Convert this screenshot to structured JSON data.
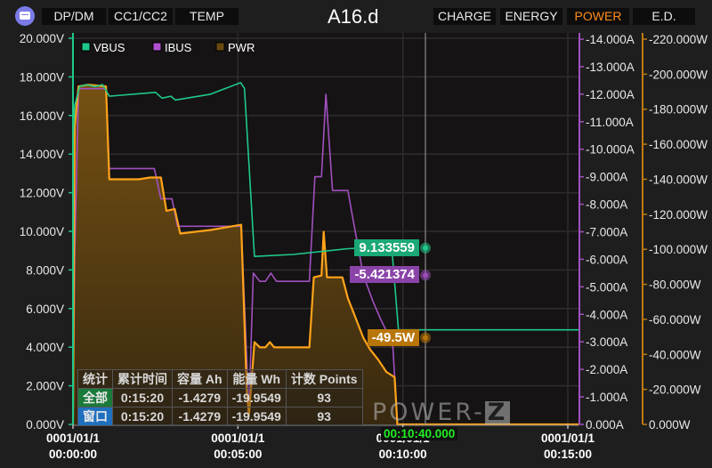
{
  "header": {
    "title": "A16.d",
    "left_tabs": [
      {
        "label": "DP/DM"
      },
      {
        "label": "CC1/CC2"
      },
      {
        "label": "TEMP"
      }
    ],
    "right_tabs": [
      {
        "label": "CHARGE",
        "active": false
      },
      {
        "label": "ENERGY",
        "active": false
      },
      {
        "label": "POWER",
        "active": true
      },
      {
        "label": "E.D.",
        "active": false
      }
    ]
  },
  "colors": {
    "vbus": "#1fc98a",
    "ibus": "#a050c0",
    "pwr": "#ffa31a",
    "pwr_fill": "#6b4a10",
    "active_tab": "#ff8c1a",
    "cursor_time": "#22ee22"
  },
  "chart_data": {
    "type": "line",
    "title": "A16.d",
    "xlabel": "",
    "x_unit": "seconds",
    "xlim": [
      0,
      920
    ],
    "x_ticks": [
      {
        "value": 0,
        "label_date": "0001/01/1",
        "label_time": "00:00:00"
      },
      {
        "value": 300,
        "label_date": "0001/01/1",
        "label_time": "00:05:00"
      },
      {
        "value": 600,
        "label_date": "0001/01/1",
        "label_time": "00:10:00"
      },
      {
        "value": 900,
        "label_date": "0001/01/1",
        "label_time": "00:15:00"
      }
    ],
    "axes": {
      "voltage": {
        "position": "left",
        "range": [
          0,
          20
        ],
        "ticks": [
          "0.000V",
          "2.000V",
          "4.000V",
          "6.000V",
          "8.000V",
          "10.000V",
          "12.000V",
          "14.000V",
          "16.000V",
          "18.000V",
          "20.000V"
        ]
      },
      "current": {
        "position": "right",
        "range": [
          0,
          -14
        ],
        "ticks": [
          "0.000A",
          "-1.000A",
          "-2.000A",
          "-3.000A",
          "-4.000A",
          "-5.000A",
          "-6.000A",
          "-7.000A",
          "-8.000A",
          "-9.000A",
          "-10.000A",
          "-11.000A",
          "-12.000A",
          "-13.000A",
          "-14.000A"
        ]
      },
      "power": {
        "position": "far-right",
        "range": [
          0,
          -220
        ],
        "ticks": [
          "0.000W",
          "-20.000W",
          "-40.000W",
          "-60.000W",
          "-80.000W",
          "-100.000W",
          "-120.000W",
          "-140.000W",
          "-160.000W",
          "-180.000W",
          "-200.000W",
          "-220.000W"
        ]
      }
    },
    "legend": {
      "placement": "top-left",
      "entries": [
        "VBUS",
        "IBUS",
        "PWR"
      ]
    },
    "grid": true,
    "series": [
      {
        "name": "VBUS",
        "axis": "voltage",
        "points": [
          [
            0,
            14.8
          ],
          [
            3,
            16.5
          ],
          [
            12,
            17.5
          ],
          [
            24,
            17.6
          ],
          [
            40,
            17.5
          ],
          [
            54,
            17.6
          ],
          [
            66,
            17.0
          ],
          [
            150,
            17.2
          ],
          [
            162,
            16.9
          ],
          [
            178,
            17.0
          ],
          [
            186,
            16.8
          ],
          [
            250,
            17.1
          ],
          [
            305,
            17.7
          ],
          [
            312,
            17.4
          ],
          [
            330,
            8.7
          ],
          [
            400,
            8.8
          ],
          [
            500,
            9.1
          ],
          [
            528,
            9.133
          ],
          [
            580,
            9.1
          ],
          [
            592,
            4.9
          ],
          [
            920,
            4.9
          ]
        ]
      },
      {
        "name": "IBUS",
        "axis": "current",
        "points": [
          [
            0,
            0
          ],
          [
            3,
            -6.0
          ],
          [
            10,
            -12.2
          ],
          [
            60,
            -12.2
          ],
          [
            66,
            -9.3
          ],
          [
            148,
            -9.3
          ],
          [
            160,
            -8.2
          ],
          [
            180,
            -8.2
          ],
          [
            190,
            -7.2
          ],
          [
            306,
            -7.2
          ],
          [
            320,
            -0.5
          ],
          [
            328,
            -5.5
          ],
          [
            340,
            -5.2
          ],
          [
            350,
            -5.2
          ],
          [
            360,
            -5.5
          ],
          [
            370,
            -5.2
          ],
          [
            430,
            -5.2
          ],
          [
            440,
            -9.0
          ],
          [
            452,
            -9.0
          ],
          [
            460,
            -12.0
          ],
          [
            472,
            -8.5
          ],
          [
            500,
            -8.5
          ],
          [
            508,
            -7.6
          ],
          [
            528,
            -5.421
          ],
          [
            545,
            -4.5
          ],
          [
            560,
            -3.8
          ],
          [
            570,
            -3.4
          ],
          [
            582,
            -2.8
          ],
          [
            590,
            0
          ],
          [
            920,
            0
          ]
        ]
      },
      {
        "name": "PWR",
        "axis": "power",
        "filled": true,
        "points": [
          [
            0,
            0
          ],
          [
            3,
            -170
          ],
          [
            10,
            -193
          ],
          [
            28,
            -194
          ],
          [
            60,
            -193
          ],
          [
            66,
            -140
          ],
          [
            120,
            -140
          ],
          [
            140,
            -141
          ],
          [
            160,
            -141
          ],
          [
            170,
            -122
          ],
          [
            185,
            -123
          ],
          [
            195,
            -109
          ],
          [
            250,
            -111
          ],
          [
            306,
            -114
          ],
          [
            316,
            -20
          ],
          [
            320,
            -5
          ],
          [
            330,
            -47
          ],
          [
            340,
            -44
          ],
          [
            350,
            -44
          ],
          [
            358,
            -47
          ],
          [
            366,
            -44
          ],
          [
            430,
            -44
          ],
          [
            438,
            -84
          ],
          [
            452,
            -85
          ],
          [
            456,
            -110
          ],
          [
            462,
            -84
          ],
          [
            490,
            -84
          ],
          [
            500,
            -72
          ],
          [
            510,
            -64
          ],
          [
            528,
            -49.5
          ],
          [
            540,
            -43
          ],
          [
            555,
            -37
          ],
          [
            570,
            -30
          ],
          [
            585,
            -27
          ],
          [
            590,
            0
          ],
          [
            920,
            0
          ]
        ]
      }
    ],
    "cursor": {
      "time_label": "00:10:40.000",
      "x": 640,
      "readouts": [
        {
          "series": "VBUS",
          "label": "9.133559",
          "value": 9.133559
        },
        {
          "series": "IBUS",
          "label": "-5.421374",
          "value": -5.421374
        },
        {
          "series": "PWR",
          "label": "-49.5W",
          "value": -49.5
        }
      ]
    }
  },
  "stats_table": {
    "headers": [
      "统计",
      "累计时间",
      "容量 Ah",
      "能量 Wh",
      "计数 Points"
    ],
    "rows": [
      {
        "label": "全部",
        "time": "0:15:20",
        "capacity": "-1.4279",
        "energy": "-19.9549",
        "points": "93"
      },
      {
        "label": "窗口",
        "time": "0:15:20",
        "capacity": "-1.4279",
        "energy": "-19.9549",
        "points": "93"
      }
    ]
  },
  "watermark": {
    "text": "POWER-",
    "badge": "Z"
  }
}
